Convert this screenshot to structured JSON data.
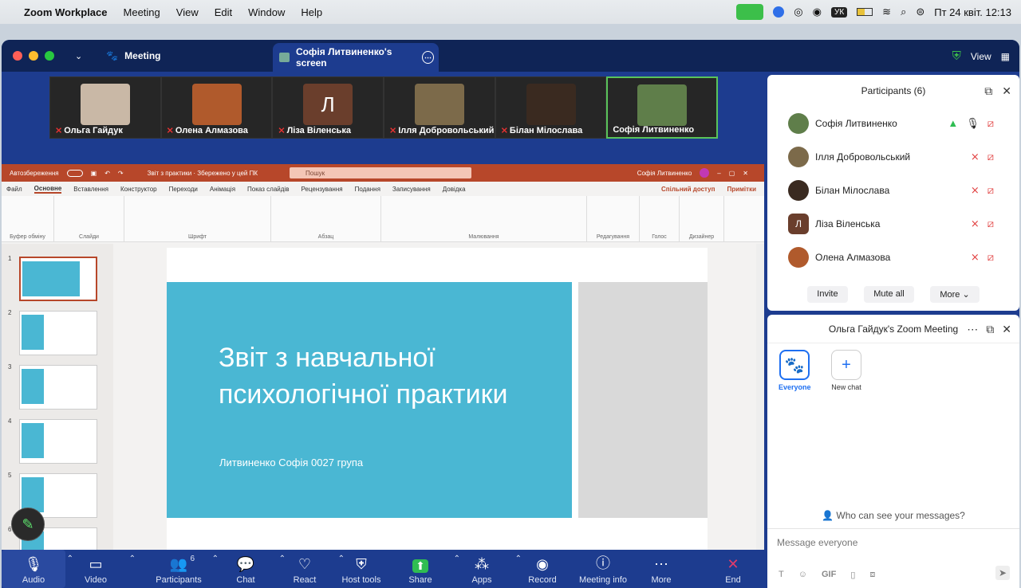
{
  "macbar": {
    "app": "Zoom Workplace",
    "menus": [
      "Meeting",
      "View",
      "Edit",
      "Window",
      "Help"
    ],
    "lang": "УК",
    "datetime": "Пт 24 квіт.  12:13"
  },
  "window": {
    "tab_meeting": "Meeting",
    "tab_screen": "Софія Литвиненко's screen",
    "view": "View"
  },
  "thumbs": [
    {
      "name": "Ольга Гайдук",
      "muted": true,
      "color": "#c9b8a6"
    },
    {
      "name": "Олена Алмазова",
      "muted": true,
      "color": "#b05a2c"
    },
    {
      "name": "Ліза Віленська",
      "muted": true,
      "letter": "Л",
      "color": "#6a3e2c"
    },
    {
      "name": "Ілля Добровольський",
      "muted": true,
      "color": "#7c6a4a"
    },
    {
      "name": "Білан Мілослава",
      "muted": true,
      "color": "#3a2a20"
    },
    {
      "name": "Софія Литвиненко",
      "muted": false,
      "color": "#5f7e4a"
    }
  ],
  "ppt": {
    "autosave": "Автозбереження",
    "doc": "Звіт з практики · Збережено у цей ПК",
    "search": "Пошук",
    "user": "Софія Литвиненко",
    "tabs": [
      "Файл",
      "Основне",
      "Вставлення",
      "Конструктор",
      "Переходи",
      "Анімація",
      "Показ слайдів",
      "Рецензування",
      "Подання",
      "Записування",
      "Довідка"
    ],
    "share": "Спільний доступ",
    "notes": "Примітки",
    "groups": [
      "Буфер обміну",
      "Слайди",
      "Шрифт",
      "Абзац",
      "Малювання",
      "Редагування",
      "Голос",
      "Дизайнер"
    ],
    "slide_title": "Звіт з навчальної психологічної практики",
    "slide_subtitle": "Литвиненко Софія 0027 група",
    "slide_numbers": [
      "1",
      "2",
      "3",
      "4",
      "5",
      "6"
    ]
  },
  "toolbar": [
    {
      "label": "Audio",
      "icon": "🎙",
      "caret": true
    },
    {
      "label": "Video",
      "icon": "▭",
      "caret": true
    },
    {
      "label": "Participants",
      "icon": "👥",
      "caret": true,
      "badge": "6"
    },
    {
      "label": "Chat",
      "icon": "💬",
      "caret": true
    },
    {
      "label": "React",
      "icon": "♡",
      "caret": true
    },
    {
      "label": "Host tools",
      "icon": "⛨",
      "caret": false
    },
    {
      "label": "Share",
      "icon": "⬆",
      "caret": true
    },
    {
      "label": "Apps",
      "icon": "⁂",
      "caret": true
    },
    {
      "label": "Record",
      "icon": "◉",
      "caret": false
    },
    {
      "label": "Meeting info",
      "icon": "ⓘ",
      "caret": false
    },
    {
      "label": "More",
      "icon": "⋯",
      "caret": false
    },
    {
      "label": "End",
      "icon": "✕",
      "caret": false
    }
  ],
  "participants": {
    "title": "Participants (6)",
    "list": [
      {
        "name": "Софія Литвиненко",
        "color": "#5f7e4a",
        "muted": false
      },
      {
        "name": "Ілля Добровольський",
        "color": "#7c6a4a",
        "muted": true
      },
      {
        "name": "Білан Мілослава",
        "color": "#3a2a20",
        "muted": true
      },
      {
        "name": "Ліза Віленська",
        "color": "#6a3e2c",
        "letter": "Л",
        "muted": true
      },
      {
        "name": "Олена Алмазова",
        "color": "#b05a2c",
        "muted": true
      }
    ],
    "invite": "Invite",
    "mute_all": "Mute all",
    "more": "More"
  },
  "chat": {
    "title": "Ольга Гайдук's Zoom Meeting",
    "everyone": "Everyone",
    "new_chat": "New chat",
    "who": "Who can see your messages?",
    "placeholder": "Message everyone",
    "gif": "GIF"
  }
}
